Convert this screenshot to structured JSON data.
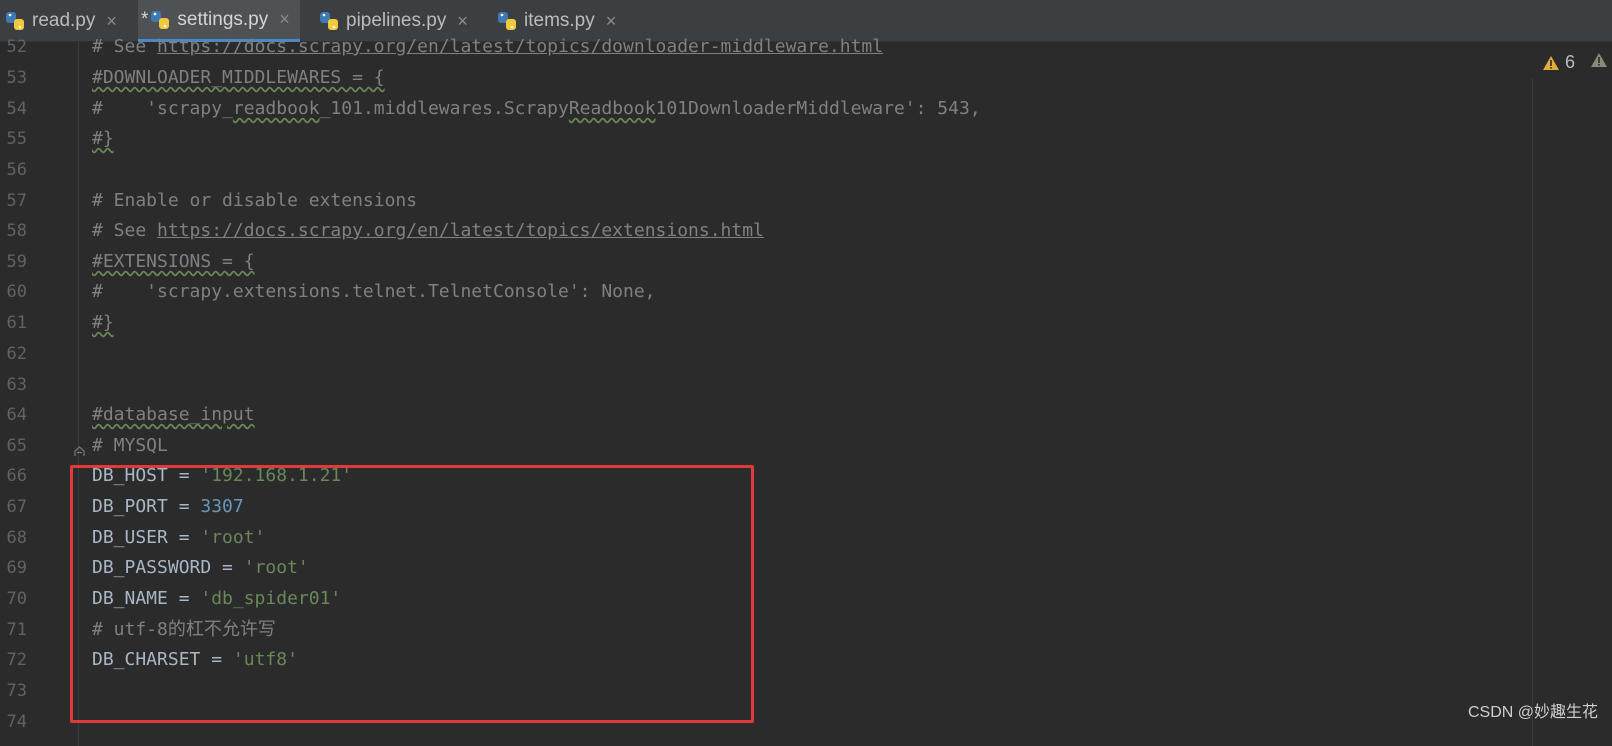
{
  "tabs": [
    {
      "label": "read.py",
      "modified": "",
      "active": false
    },
    {
      "label": "settings.py",
      "modified": "*",
      "active": true
    },
    {
      "label": "pipelines.py",
      "modified": "",
      "active": false
    },
    {
      "label": "items.py",
      "modified": "",
      "active": false
    }
  ],
  "close_glyph": "×",
  "warnings": {
    "count": "6"
  },
  "lines": {
    "52": {
      "number": "52",
      "p1": "# See ",
      "link": "https://docs.scrapy.org/en/latest/topics/downloader-middleware.html"
    },
    "53": {
      "number": "53",
      "text": "#DOWNLOADER_MIDDLEWARES = {"
    },
    "54": {
      "number": "54",
      "p1": "#    'scrapy_",
      "w1": "readbook",
      "p2": "_101.middlewares.Scrapy",
      "w2": "Readbook",
      "p3": "101DownloaderMiddleware': 543,"
    },
    "55": {
      "number": "55",
      "text": "#}"
    },
    "56": {
      "number": "56"
    },
    "57": {
      "number": "57",
      "text": "# Enable or disable extensions"
    },
    "58": {
      "number": "58",
      "p1": "# See ",
      "link": "https://docs.scrapy.org/en/latest/topics/extensions.html"
    },
    "59": {
      "number": "59",
      "text": "#EXTENSIONS = {"
    },
    "60": {
      "number": "60",
      "text": "#    'scrapy.extensions.telnet.TelnetConsole': None,"
    },
    "61": {
      "number": "61",
      "text": "#}"
    },
    "62": {
      "number": "62"
    },
    "63": {
      "number": "63"
    },
    "64": {
      "number": "64",
      "text": "#database_input"
    },
    "65": {
      "number": "65",
      "text": "# MYSQL"
    },
    "66": {
      "number": "66",
      "name": "DB_HOST",
      "op": " = ",
      "value": "'192.168.1.21'"
    },
    "67": {
      "number": "67",
      "name": "DB_PORT",
      "op": " = ",
      "value": "3307"
    },
    "68": {
      "number": "68",
      "name": "DB_USER",
      "op": " = ",
      "value": "'root'"
    },
    "69": {
      "number": "69",
      "name": "DB_PASSWORD",
      "op": " = ",
      "value": "'root'"
    },
    "70": {
      "number": "70",
      "name": "DB_NAME",
      "op": " = ",
      "value": "'db_spider01'"
    },
    "71": {
      "number": "71",
      "text": "# utf-8的杠不允许写"
    },
    "72": {
      "number": "72",
      "name": "DB_CHARSET",
      "op": " = ",
      "value": "'utf8'"
    },
    "73": {
      "number": "73"
    },
    "74": {
      "number": "74"
    }
  },
  "watermark": "CSDN @妙趣生花",
  "colors": {
    "background": "#2b2b2b",
    "comment": "#808080",
    "string": "#6a8759",
    "number": "#6897bb",
    "identifier": "#a9b7c6",
    "highlight_box": "#e03a3a",
    "active_tab_underline": "#4a88c7"
  }
}
